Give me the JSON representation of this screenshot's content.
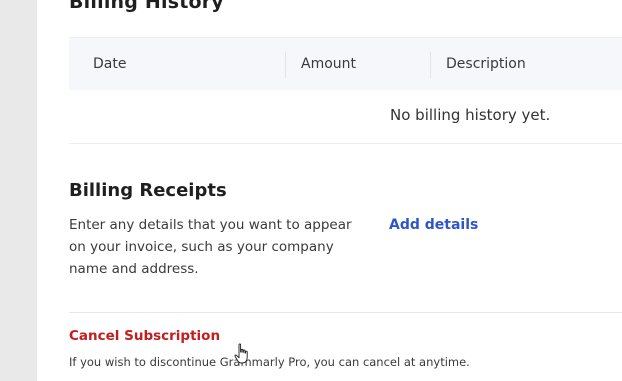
{
  "billing_history": {
    "title": "Billing History",
    "columns": [
      "Date",
      "Amount",
      "Description"
    ],
    "empty_message": "No billing history yet."
  },
  "billing_receipts": {
    "title": "Billing Receipts",
    "description": "Enter any details that you want to appear on your invoice, such as your company name and address.",
    "action_label": "Add details",
    "action_color": "#2f56c8"
  },
  "cancel": {
    "link_label": "Cancel Subscription",
    "link_color": "#c41d1d",
    "note": "If you wish to discontinue Grammarly Pro, you can cancel at anytime."
  },
  "icons": {
    "cursor": "hand-pointer-icon"
  }
}
